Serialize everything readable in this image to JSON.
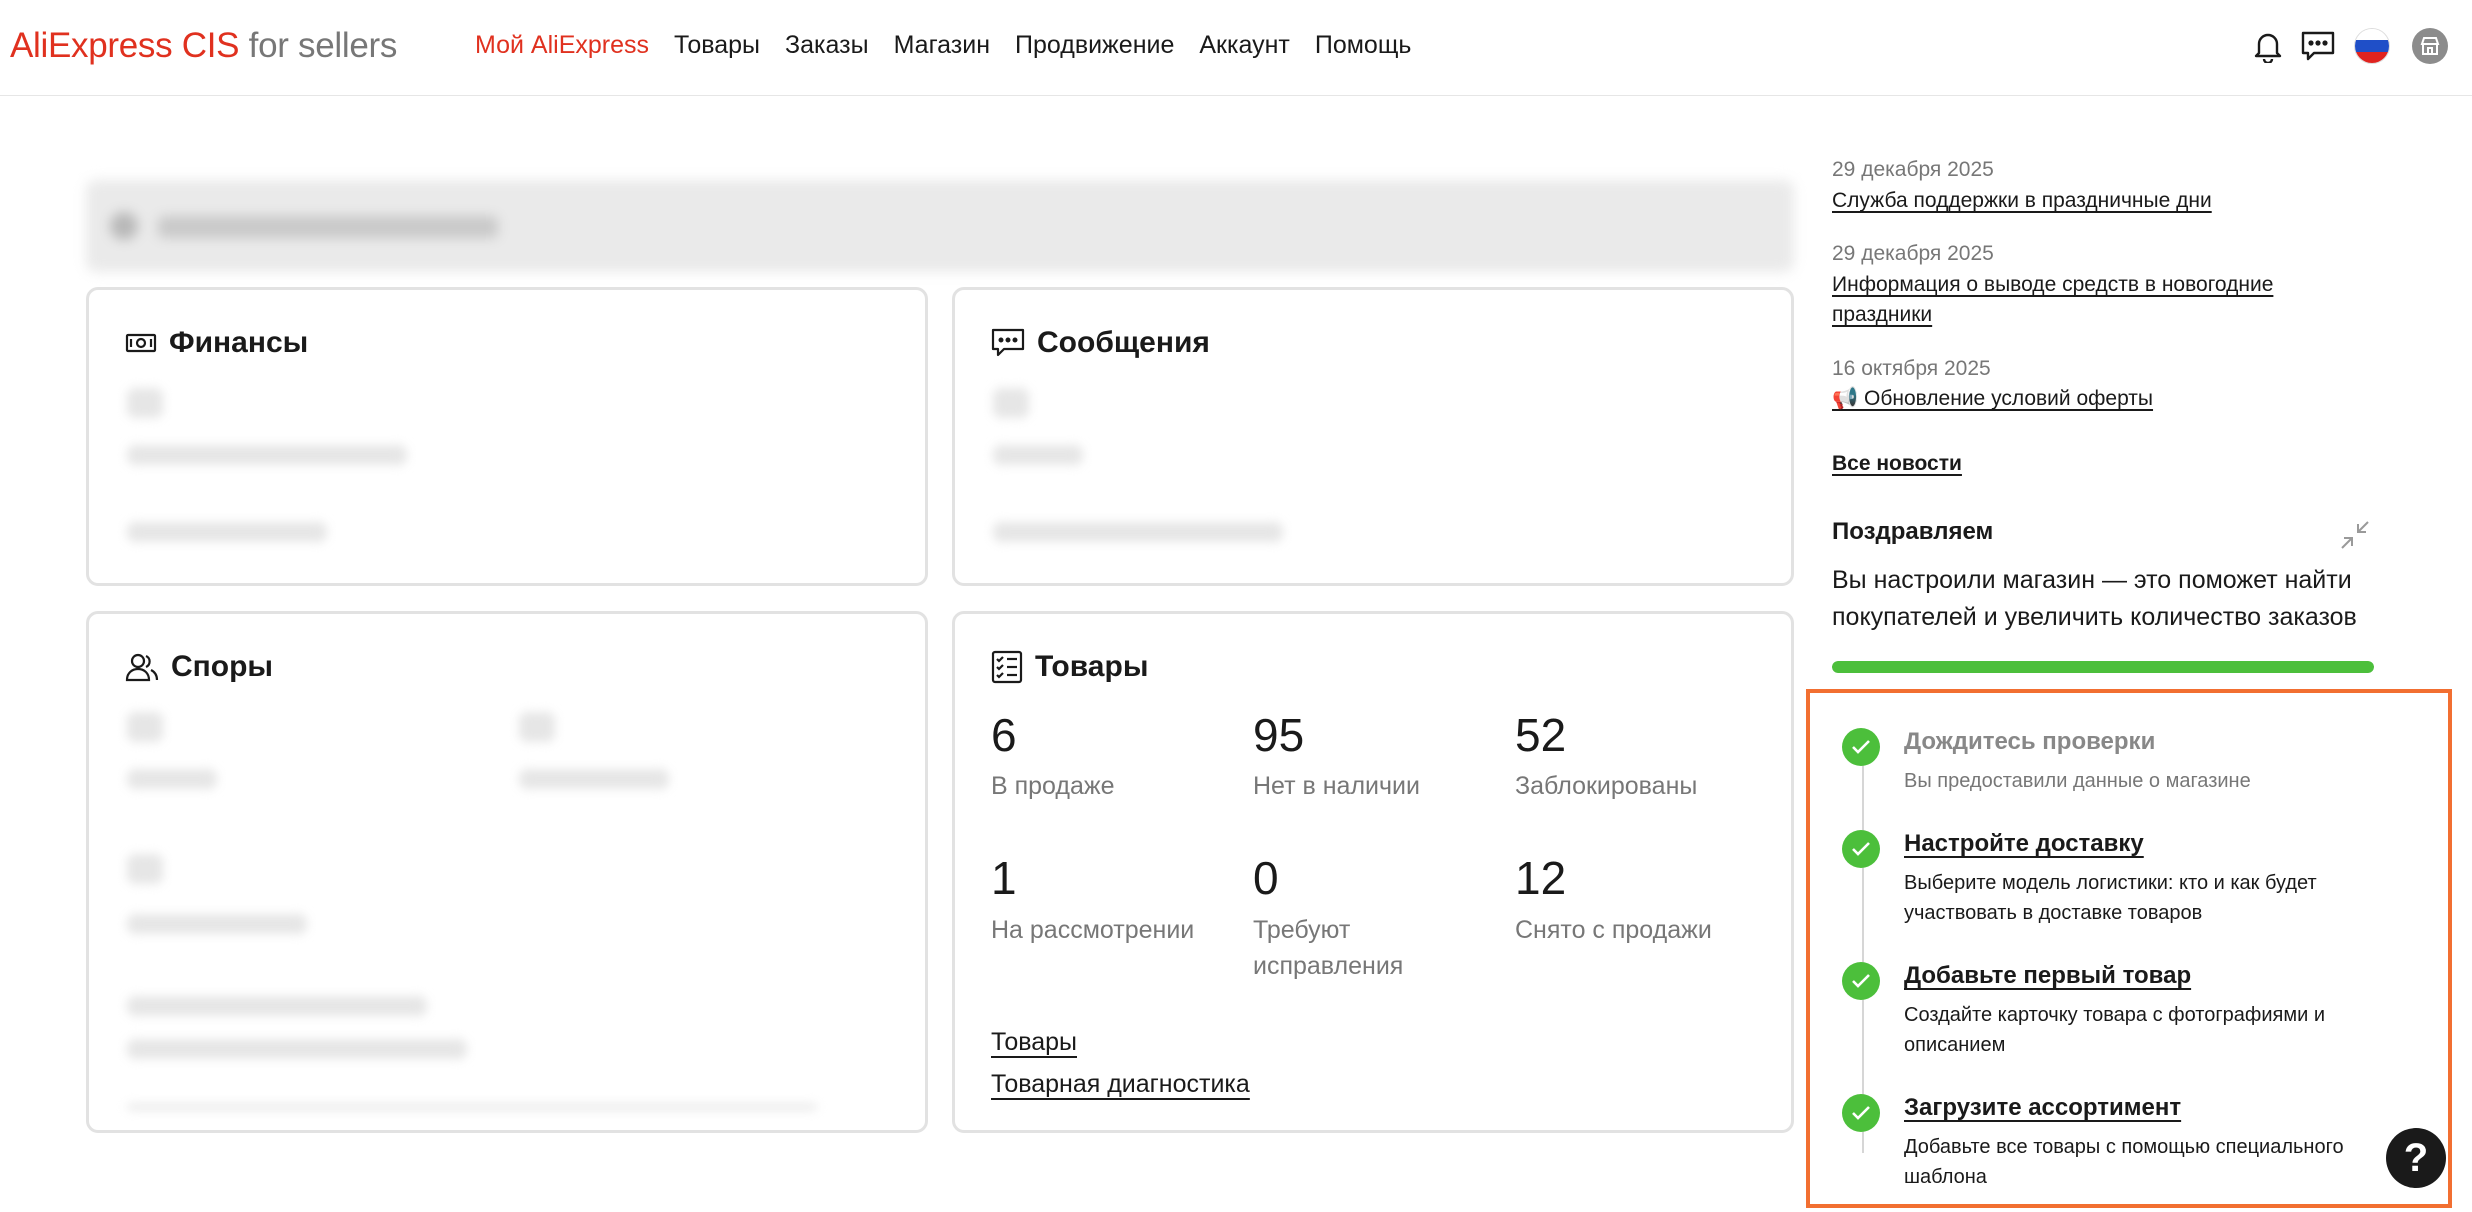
{
  "header": {
    "logo_brand": "AliExpress CIS",
    "logo_suffix": "for sellers",
    "nav": [
      {
        "label": "Мой AliExpress",
        "active": true
      },
      {
        "label": "Товары",
        "active": false
      },
      {
        "label": "Заказы",
        "active": false
      },
      {
        "label": "Магазин",
        "active": false
      },
      {
        "label": "Продвижение",
        "active": false
      },
      {
        "label": "Аккаунт",
        "active": false
      },
      {
        "label": "Помощь",
        "active": false
      }
    ],
    "icons": [
      "bell-icon",
      "message-icon",
      "russia-flag-icon",
      "store-avatar-icon"
    ]
  },
  "cards": {
    "finance": {
      "title": "Финансы",
      "icon": "money-icon"
    },
    "messages": {
      "title": "Сообщения",
      "icon": "chat-icon"
    },
    "disputes": {
      "title": "Споры",
      "icon": "users-icon"
    },
    "products": {
      "title": "Товары",
      "icon": "checklist-icon",
      "stats": [
        {
          "value": "6",
          "label": "В продаже"
        },
        {
          "value": "95",
          "label": "Нет в наличии"
        },
        {
          "value": "52",
          "label": "Заблокированы"
        },
        {
          "value": "1",
          "label": "На рассмотрении"
        },
        {
          "value": "0",
          "label": "Требуют исправления"
        },
        {
          "value": "12",
          "label": "Снято с продажи"
        }
      ],
      "links": [
        "Товары",
        "Товарная диагностика"
      ]
    }
  },
  "news": {
    "items": [
      {
        "date": "29 декабря 2025",
        "title": "Служба поддержки в праздничные дни"
      },
      {
        "date": "29 декабря 2025",
        "title": "Информация о выводе средств в новогодние праздники"
      },
      {
        "date": "16 октября 2025",
        "title": "📢 Обновление условий оферты"
      }
    ],
    "all_label": "Все новости"
  },
  "onboarding": {
    "title": "Поздравляем",
    "text": "Вы настроили магазин — это поможет найти покупателей и увеличить количество заказов",
    "progress_percent": 100,
    "accent": "#4cbf3b",
    "steps": [
      {
        "title": "Дождитесь проверки",
        "desc": "Вы предоставили данные о магазине",
        "done": true
      },
      {
        "title": "Настройте доставку",
        "desc": "Выберите модель логистики: кто и как будет участвовать в доставке товаров",
        "done": true
      },
      {
        "title": "Добавьте первый товар",
        "desc": "Создайте карточку товара с фотографиями и описанием",
        "done": true
      },
      {
        "title": "Загрузите ассортимент",
        "desc": "Добавьте все товары с помощью специального шаблона",
        "done": true
      }
    ]
  },
  "help": {
    "label": "?"
  },
  "colors": {
    "brand": "#e0311f",
    "highlight_border": "#f26f31",
    "success": "#4cbf3b"
  }
}
